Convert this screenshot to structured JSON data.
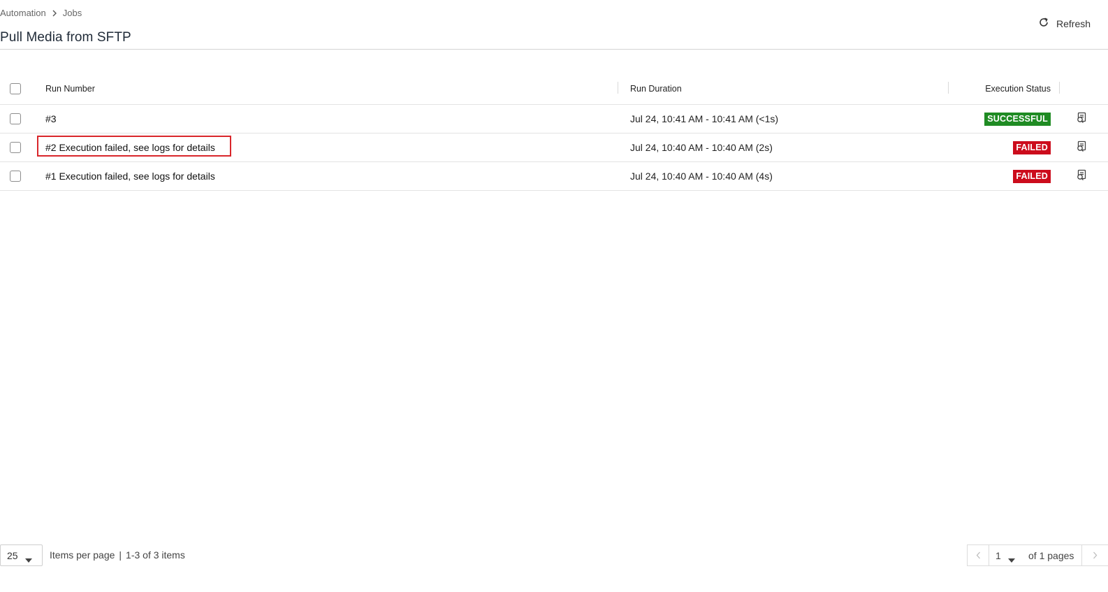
{
  "breadcrumb": {
    "items": [
      "Automation",
      "Jobs"
    ]
  },
  "page": {
    "title": "Pull Media from SFTP",
    "refresh_label": "Refresh"
  },
  "table": {
    "columns": {
      "run_number": "Run Number",
      "run_duration": "Run Duration",
      "execution_status": "Execution Status"
    },
    "rows": [
      {
        "run": "#3",
        "duration": "Jul 24, 10:41 AM - 10:41 AM (<1s)",
        "status": "SUCCESSFUL",
        "status_color": "#1f8b23"
      },
      {
        "run": "#2 Execution failed, see logs for details",
        "duration": "Jul 24, 10:40 AM - 10:40 AM (2s)",
        "status": "FAILED",
        "status_color": "#cc0c1c"
      },
      {
        "run": "#1 Execution failed, see logs for details",
        "duration": "Jul 24, 10:40 AM - 10:40 AM (4s)",
        "status": "FAILED",
        "status_color": "#cc0c1c"
      }
    ]
  },
  "footer": {
    "per_page_value": "25",
    "items_per_page_label": "Items per page",
    "separator": "|",
    "range_label": "1-3 of 3 items",
    "current_page": "1",
    "of_pages_label": "of 1 pages"
  },
  "icons": {
    "breadcrumb_separator": "chevron-right-icon",
    "refresh": "refresh-icon",
    "row_action": "view-logs-icon",
    "dropdown": "caret-down-icon",
    "prev": "chevron-left-icon",
    "next": "chevron-right-icon"
  },
  "colors": {
    "success": "#1f8b23",
    "failed": "#cc0c1c",
    "highlight": "#d9262b"
  }
}
